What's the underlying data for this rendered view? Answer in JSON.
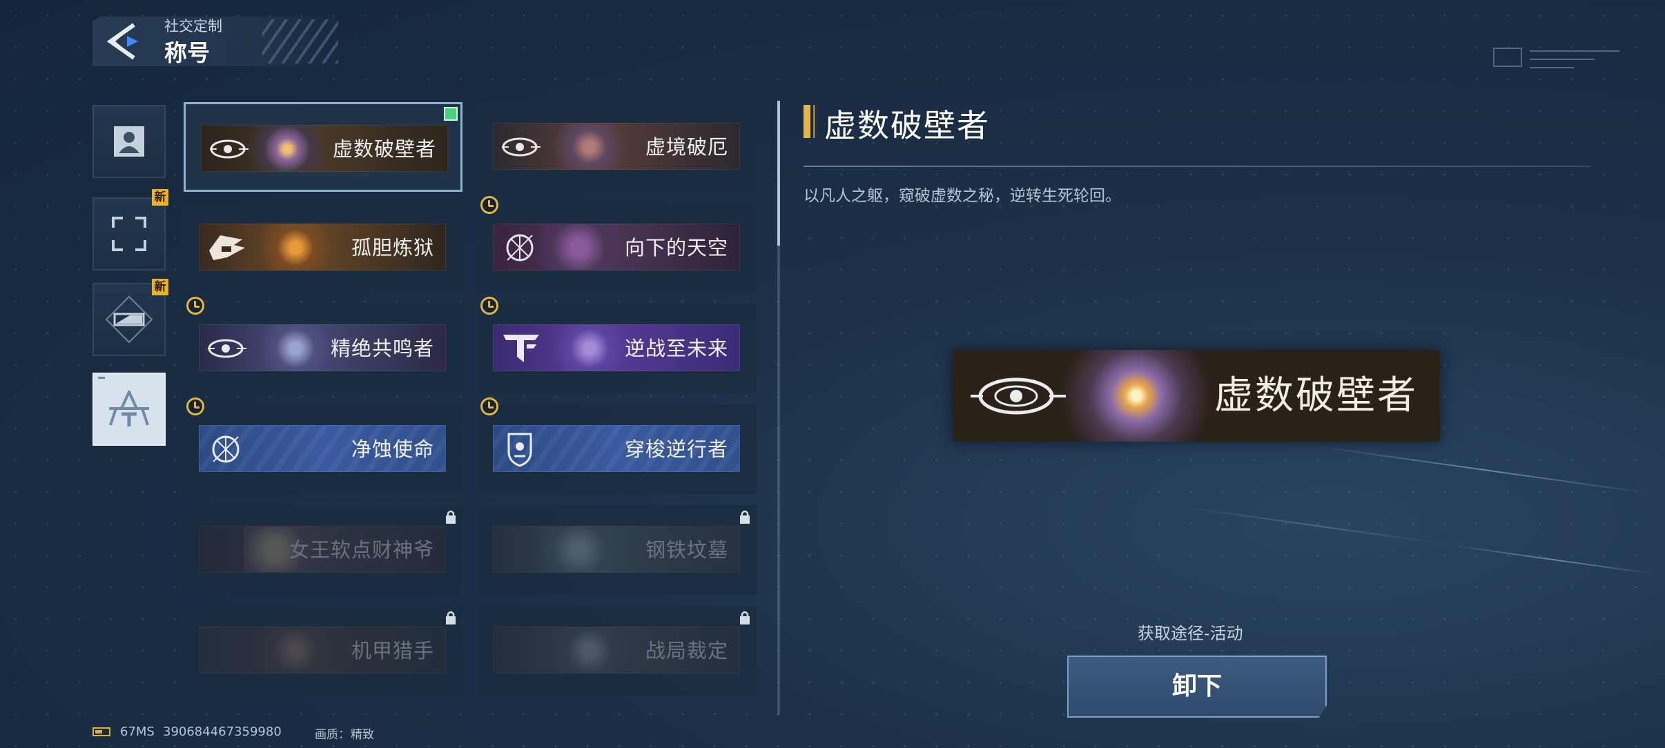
{
  "header": {
    "subtitle": "社交定制",
    "title": "称号",
    "back_icon": "back-arrow-icon"
  },
  "categories": [
    {
      "icon": "avatar-icon",
      "new": false,
      "active": false
    },
    {
      "icon": "frame-icon",
      "new": true,
      "active": false
    },
    {
      "icon": "nameplate-icon",
      "new": true,
      "active": false
    },
    {
      "icon": "title-emblem-icon",
      "new": false,
      "active": true
    }
  ],
  "new_badge_label": "新",
  "titles": [
    {
      "name": "虚数破壁者",
      "selected": true,
      "equipped": true,
      "timed": false,
      "locked": false
    },
    {
      "name": "虚境破厄",
      "selected": false,
      "equipped": false,
      "timed": false,
      "locked": false
    },
    {
      "name": "孤胆炼狱",
      "selected": false,
      "equipped": false,
      "timed": false,
      "locked": false
    },
    {
      "name": "向下的天空",
      "selected": false,
      "equipped": false,
      "timed": true,
      "locked": false
    },
    {
      "name": "精绝共鸣者",
      "selected": false,
      "equipped": false,
      "timed": true,
      "locked": false
    },
    {
      "name": "逆战至未来",
      "selected": false,
      "equipped": false,
      "timed": true,
      "locked": false
    },
    {
      "name": "净蚀使命",
      "selected": false,
      "equipped": false,
      "timed": true,
      "locked": false
    },
    {
      "name": "穿梭逆行者",
      "selected": false,
      "equipped": false,
      "timed": true,
      "locked": false
    },
    {
      "name": "女王软点财神爷",
      "selected": false,
      "equipped": false,
      "timed": false,
      "locked": true
    },
    {
      "name": "钢铁坟墓",
      "selected": false,
      "equipped": false,
      "timed": false,
      "locked": true
    },
    {
      "name": "机甲猎手",
      "selected": false,
      "equipped": false,
      "timed": false,
      "locked": true
    },
    {
      "name": "战局裁定",
      "selected": false,
      "equipped": false,
      "timed": false,
      "locked": true
    }
  ],
  "detail": {
    "title": "虚数破壁者",
    "description": "以凡人之躯，窥破虚数之秘，逆转生死轮回。",
    "banner_label": "虚数破壁者",
    "source": "获取途径-活动",
    "action_label": "卸下"
  },
  "status": {
    "ping": "67MS",
    "id": "390684467359980",
    "quality_label": "画质：",
    "quality_value": "精致"
  },
  "colors": {
    "accent": "#e8b34a",
    "equipped": "#4cd07a",
    "timer": "#e2b640"
  }
}
